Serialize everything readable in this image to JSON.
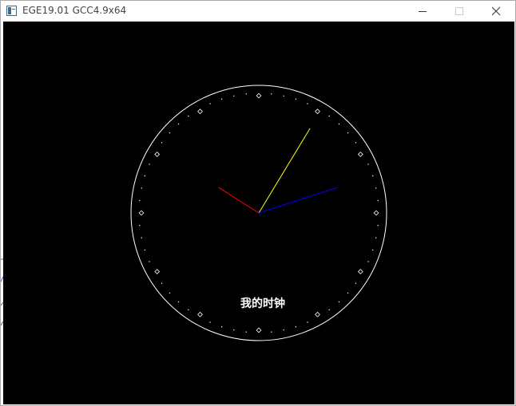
{
  "window": {
    "title": "EGE19.01 GCC4.9x64",
    "controls": {
      "minimize_icon": "minimize-icon",
      "maximize_icon": "maximize-icon",
      "close_icon": "close-icon"
    }
  },
  "clock": {
    "caption": "我的时钟",
    "time": {
      "hour": 10,
      "minute": 5,
      "second": 12
    },
    "colors": {
      "face": "#ffffff",
      "hour_hand": "#ff0000",
      "minute_hand": "#ffff00",
      "second_hand": "#0000ff",
      "background": "#000000"
    }
  }
}
